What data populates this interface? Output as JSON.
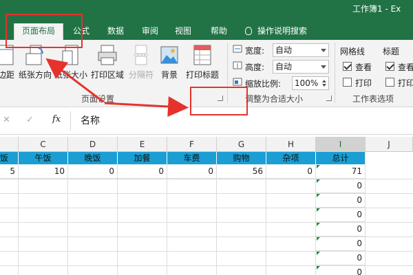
{
  "window": {
    "title": "工作簿1 - Ex"
  },
  "tabs": {
    "file": "",
    "page_layout": "页面布局",
    "formulas": "公式",
    "data": "数据",
    "review": "审阅",
    "view": "视图",
    "help": "帮助",
    "tell_me": "操作说明搜索"
  },
  "ribbon": {
    "margins": "边距",
    "orientation": "纸张方向",
    "size": "纸张大小",
    "print_area": "打印区域",
    "breaks": "分隔符",
    "background": "背景",
    "print_titles": "打印标题",
    "page_setup_group": "页面设置",
    "width_label": "宽度:",
    "width_value": "自动",
    "height_label": "高度:",
    "height_value": "自动",
    "scale_label": "缩放比例:",
    "scale_value": "100%",
    "scale_group": "调整为合适大小",
    "gridlines_title": "网格线",
    "gridlines_view": "查看",
    "gridlines_print": "打印",
    "headings_title": "标题",
    "headings_view": "查看",
    "headings_print": "打印",
    "sheet_options_group": "工作表选项",
    "gridlines_view_checked": true,
    "gridlines_print_checked": false,
    "headings_view_checked": true,
    "headings_print_checked": false
  },
  "formula_bar": {
    "cancel": "✕",
    "enter": "✓",
    "fx": "fx",
    "content": "名称"
  },
  "grid": {
    "columns": [
      "C",
      "D",
      "E",
      "F",
      "G",
      "H",
      "I",
      "J"
    ],
    "header_row": [
      "饭",
      "午饭",
      "晚饭",
      "加餐",
      "车费",
      "购物",
      "杂项",
      "总计"
    ],
    "row1": [
      "5",
      "10",
      "0",
      "0",
      "0",
      "56",
      "0",
      "71"
    ],
    "totals_below": [
      "0",
      "0",
      "0",
      "0",
      "0",
      "0",
      "0"
    ]
  },
  "colors": {
    "excel_green": "#217346",
    "header_fill": "#1a9ed3",
    "annotation_red": "#e5322d"
  }
}
